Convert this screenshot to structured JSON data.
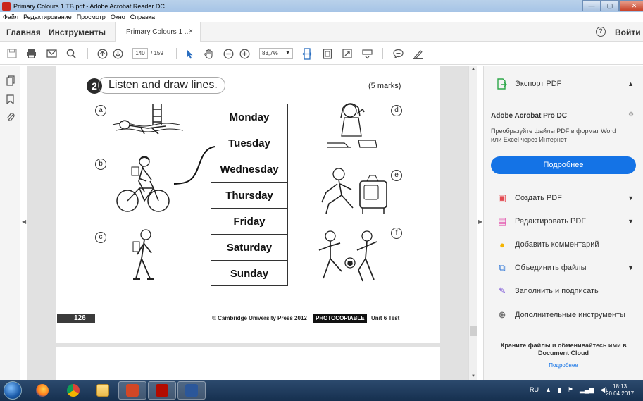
{
  "window": {
    "title": "Primary Colours 1 TB.pdf - Adobe Acrobat Reader DC",
    "controls": {
      "minimize": "—",
      "maximize": "▢",
      "close": "✕"
    }
  },
  "menu": [
    "Файл",
    "Редактирование",
    "Просмотр",
    "Окно",
    "Справка"
  ],
  "tabs": {
    "home": "Главная",
    "tools": "Инструменты",
    "document": "Primary Colours 1 ...",
    "close": "×"
  },
  "header": {
    "help": "?",
    "signin": "Войти"
  },
  "toolbar": {
    "page_current": "140",
    "page_total": "/ 159",
    "zoom": "83,7%",
    "icons": [
      "save-icon",
      "print-icon",
      "email-icon",
      "search-icon",
      "page-up-icon",
      "page-down-icon",
      "select-cursor-icon",
      "hand-tool-icon",
      "zoom-out-icon",
      "zoom-in-icon",
      "fit-width-icon",
      "fit-page-icon",
      "fullscreen-icon",
      "scroll-mode-icon",
      "comment-icon",
      "sign-icon"
    ]
  },
  "document": {
    "question_number": "2",
    "question_title": "Listen and draw lines.",
    "marks": "(5 marks)",
    "letters": [
      "a",
      "b",
      "c",
      "d",
      "e",
      "f"
    ],
    "days": [
      "Monday",
      "Tuesday",
      "Wednesday",
      "Thursday",
      "Friday",
      "Saturday",
      "Sunday"
    ],
    "page_number": "126",
    "copyright": "© Cambridge University Press 2012",
    "photocopiable": "PHOTOCOPIABLE",
    "unit": "Unit 6 Test"
  },
  "right_panel": {
    "export_pdf": "Экспорт PDF",
    "product_name": "Adobe Acrobat Pro DC",
    "product_desc": "Преобразуйте файлы PDF в формат Word или Excel через Интернет",
    "learn_more_button": "Подробнее",
    "tools": [
      {
        "label": "Создать PDF",
        "color": "#e34850",
        "glyph": "▣",
        "has_chevron": true
      },
      {
        "label": "Редактировать PDF",
        "color": "#e35bb0",
        "glyph": "▤",
        "has_chevron": true
      },
      {
        "label": "Добавить комментарий",
        "color": "#f5b400",
        "glyph": "●",
        "has_chevron": false
      },
      {
        "label": "Объединить файлы",
        "color": "#2d75d6",
        "glyph": "⧉",
        "has_chevron": true
      },
      {
        "label": "Заполнить и подписать",
        "color": "#7b55d6",
        "glyph": "✎",
        "has_chevron": false
      },
      {
        "label": "Дополнительные инструменты",
        "color": "#555555",
        "glyph": "⊕",
        "has_chevron": false
      }
    ],
    "cloud_text": "Храните файлы и обменивайтесь ими в Document Cloud",
    "cloud_link": "Подробнее"
  },
  "taskbar": {
    "apps": [
      "firefox",
      "chrome",
      "explorer",
      "powerpoint",
      "acrobat",
      "word"
    ],
    "language": "RU",
    "time": "18:13",
    "date": "20.04.2017"
  },
  "colors": {
    "accent": "#1473e6",
    "acrobat_red": "#e34850"
  }
}
